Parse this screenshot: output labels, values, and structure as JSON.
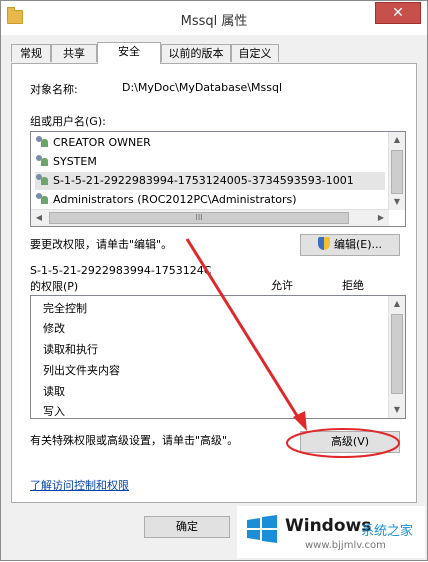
{
  "window": {
    "title": "Mssql 属性",
    "close_glyph": "✕"
  },
  "tabs": [
    {
      "label": "常规"
    },
    {
      "label": "共享"
    },
    {
      "label": "安全"
    },
    {
      "label": "以前的版本"
    },
    {
      "label": "自定义"
    }
  ],
  "object": {
    "label": "对象名称:",
    "value": "D:\\MyDoc\\MyDatabase\\Mssql"
  },
  "groups": {
    "label": "组或用户名(G):",
    "items": [
      {
        "label": "CREATOR OWNER",
        "icon": "user-group-icon"
      },
      {
        "label": "SYSTEM",
        "icon": "user-group-icon"
      },
      {
        "label": "S-1-5-21-2922983994-1753124005-3734593593-1001",
        "icon": "unknown-user-icon"
      },
      {
        "label": "Administrators (ROC2012PC\\Administrators)",
        "icon": "user-group-icon"
      }
    ],
    "hscroll_text": "III"
  },
  "edit": {
    "hint": "要更改权限，请单击\"编辑\"。",
    "button_label": "编辑(E)..."
  },
  "permissions": {
    "title_line1": "S-1-5-21-2922983994-1753124C",
    "title_line2": "的权限(P)",
    "allow_header": "允许",
    "deny_header": "拒绝",
    "items": [
      {
        "label": "完全控制"
      },
      {
        "label": "修改"
      },
      {
        "label": "读取和执行"
      },
      {
        "label": "列出文件夹内容"
      },
      {
        "label": "读取"
      },
      {
        "label": "写入"
      }
    ]
  },
  "advanced": {
    "hint": "有关特殊权限或高级设置，请单击\"高级\"。",
    "button_label": "高级(V)"
  },
  "help_link": "了解访问控制和权限",
  "footer": {
    "ok_label": "确定"
  },
  "watermark": {
    "brand": "Windows",
    "subtitle": "系统之家",
    "url": "www.bjjmlv.com"
  },
  "colors": {
    "annotation_red": "#e0282a",
    "link": "#0645ad"
  }
}
